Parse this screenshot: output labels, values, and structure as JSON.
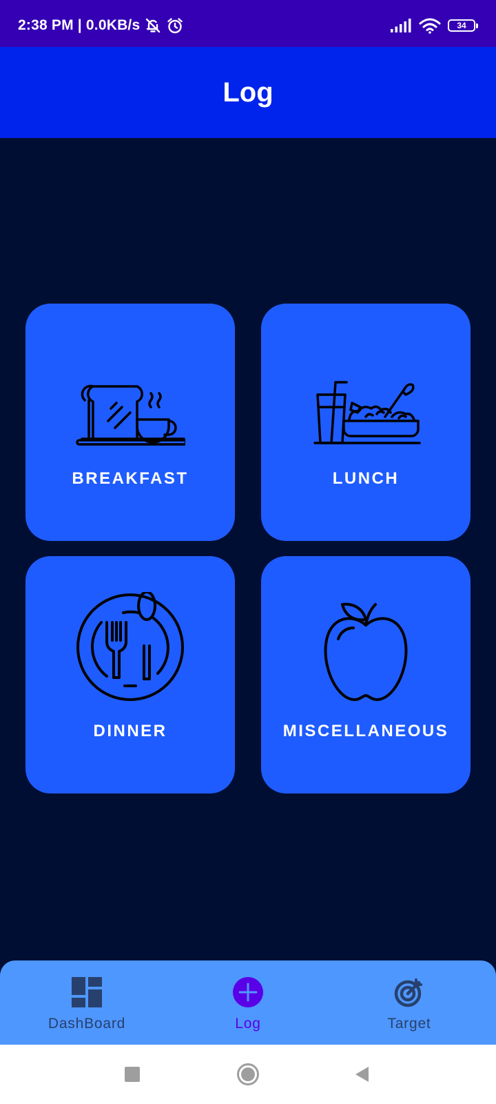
{
  "status_bar": {
    "time_and_speed": "2:38 PM | 0.0KB/s",
    "battery_level": "34"
  },
  "app_bar": {
    "title": "Log"
  },
  "cards": {
    "breakfast": {
      "label": "BREAKFAST",
      "icon": "toast-coffee-icon"
    },
    "lunch": {
      "label": "LUNCH",
      "icon": "drink-salad-bowl-icon"
    },
    "dinner": {
      "label": "DINNER",
      "icon": "plate-fork-spoon-icon"
    },
    "misc": {
      "label": "MISCELLANEOUS",
      "icon": "apple-icon"
    }
  },
  "bottom_nav": {
    "items": [
      {
        "label": "DashBoard",
        "icon": "dashboard-icon",
        "selected": false
      },
      {
        "label": "Log",
        "icon": "add-circle-icon",
        "selected": true
      },
      {
        "label": "Target",
        "icon": "target-icon",
        "selected": false
      }
    ]
  },
  "colors": {
    "status_bar": "#3500b4",
    "app_bar": "#0024ec",
    "background": "#000e33",
    "card": "#1f5cff",
    "bottom_nav": "#4e97ff",
    "nav_inactive": "#27406d",
    "nav_active": "#5a00e6"
  }
}
